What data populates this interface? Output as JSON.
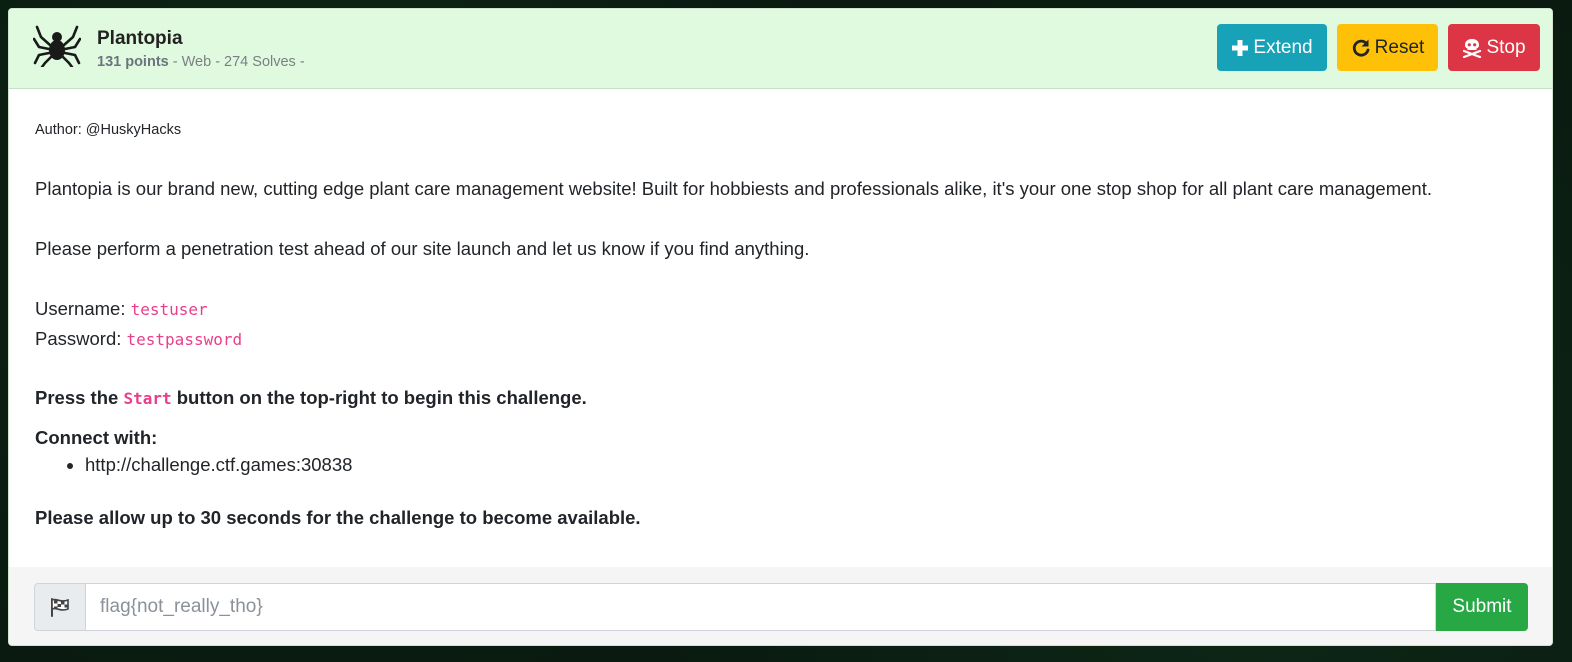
{
  "challenge": {
    "title": "Plantopia",
    "points": "131 points",
    "meta": "- Web - 274 Solves -",
    "icon": "spider-icon"
  },
  "actions": {
    "extend_label": "Extend",
    "reset_label": "Reset",
    "stop_label": "Stop"
  },
  "description": {
    "author": "Author: @HuskyHacks",
    "intro": "Plantopia is our brand new, cutting edge plant care management website! Built for hobbiests and professionals alike, it's your one stop shop for all plant care management.",
    "request": "Please perform a penetration test ahead of our site launch and let us know if you find anything.",
    "username_label": "Username:",
    "username_value": "testuser",
    "password_label": "Password:",
    "password_value": "testpassword",
    "start_prefix": "Press the",
    "start_code": "Start",
    "start_suffix": "button on the top-right to begin this challenge.",
    "connect_label": "Connect with:",
    "connect_links": [
      "http://challenge.ctf.games:30838"
    ],
    "allow_note": "Please allow up to 30 seconds for the challenge to become available."
  },
  "flag_form": {
    "placeholder": "flag{not_really_tho}",
    "submit_label": "Submit",
    "icon": "checkered-flag-icon"
  },
  "colors": {
    "header_bg": "#e0fae0",
    "extend": "#17a2b8",
    "reset": "#ffc107",
    "stop": "#dc3545",
    "submit": "#28a745",
    "code": "#e83e8c"
  }
}
